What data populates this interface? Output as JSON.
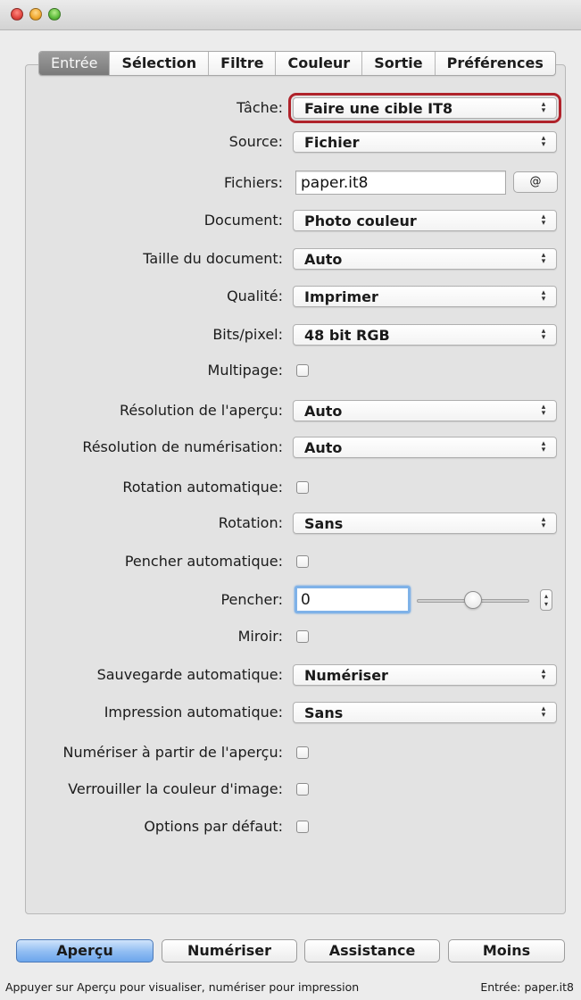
{
  "window": {
    "buttons": [
      "close",
      "minimize",
      "zoom"
    ]
  },
  "tabs": [
    {
      "label": "Entrée",
      "active": true
    },
    {
      "label": "Sélection",
      "active": false
    },
    {
      "label": "Filtre",
      "active": false
    },
    {
      "label": "Couleur",
      "active": false
    },
    {
      "label": "Sortie",
      "active": false
    },
    {
      "label": "Préférences",
      "active": false
    }
  ],
  "form": {
    "tache": {
      "label": "Tâche:",
      "value": "Faire une cible IT8"
    },
    "source": {
      "label": "Source:",
      "value": "Fichier"
    },
    "fichiers": {
      "label": "Fichiers:",
      "value": "paper.it8",
      "button": "@"
    },
    "document": {
      "label": "Document:",
      "value": "Photo couleur"
    },
    "taille": {
      "label": "Taille du document:",
      "value": "Auto"
    },
    "qualite": {
      "label": "Qualité:",
      "value": "Imprimer"
    },
    "bits": {
      "label": "Bits/pixel:",
      "value": "48 bit RGB"
    },
    "multipage": {
      "label": "Multipage:"
    },
    "resolution_apercu": {
      "label": "Résolution de l'aperçu:",
      "value": "Auto"
    },
    "resolution_numerisation": {
      "label": "Résolution de numérisation:",
      "value": "Auto"
    },
    "rotation_auto": {
      "label": "Rotation automatique:"
    },
    "rotation": {
      "label": "Rotation:",
      "value": "Sans"
    },
    "pencher_auto": {
      "label": "Pencher automatique:"
    },
    "pencher": {
      "label": "Pencher:",
      "value": "0"
    },
    "miroir": {
      "label": "Miroir:"
    },
    "sauvegarde_auto": {
      "label": "Sauvegarde automatique:",
      "value": "Numériser"
    },
    "impression_auto": {
      "label": "Impression automatique:",
      "value": "Sans"
    },
    "numeriser_apercu": {
      "label": "Numériser à partir de l'aperçu:"
    },
    "verrouiller_couleur": {
      "label": "Verrouiller la couleur d'image:"
    },
    "options_defaut": {
      "label": "Options par défaut:"
    }
  },
  "buttons": {
    "apercu": "Aperçu",
    "numeriser": "Numériser",
    "assistance": "Assistance",
    "moins": "Moins"
  },
  "status": {
    "left": "Appuyer sur Aperçu pour visualiser, numériser pour impression",
    "right": "Entrée: paper.it8"
  },
  "colors": {
    "highlight": "#b0232b",
    "primary_button": "#8fbcf2",
    "focus_ring": "#7fb2e8"
  }
}
